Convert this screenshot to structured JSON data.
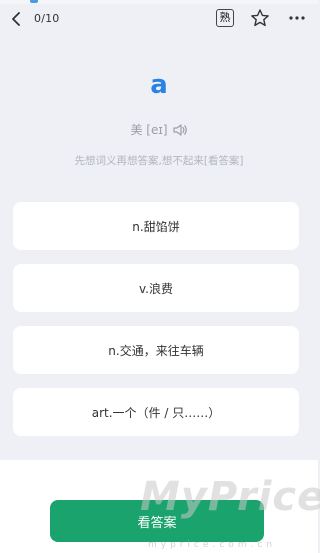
{
  "header": {
    "progress": "0/10",
    "familiar_label": "熟",
    "icons": {
      "back": "chevron-left-icon",
      "star": "star-icon",
      "more": "more-horizontal-icon"
    }
  },
  "word": {
    "text": "a",
    "phonetic": "美 [eɪ]",
    "hint": "先想词义再想答案,想不起来[看答案]"
  },
  "options": [
    {
      "label": "n.甜馅饼"
    },
    {
      "label": "v.浪费"
    },
    {
      "label": "n.交通，来往车辆"
    },
    {
      "label": "art.一个（件 / 只……）"
    }
  ],
  "footer": {
    "show_answer_label": "看答案"
  },
  "watermark": {
    "main": "MyPrice",
    "sub": "myprice.com.cn"
  },
  "colors": {
    "accent_blue": "#2a82e4",
    "button_green": "#1aa36c",
    "background": "#eef0f6"
  }
}
